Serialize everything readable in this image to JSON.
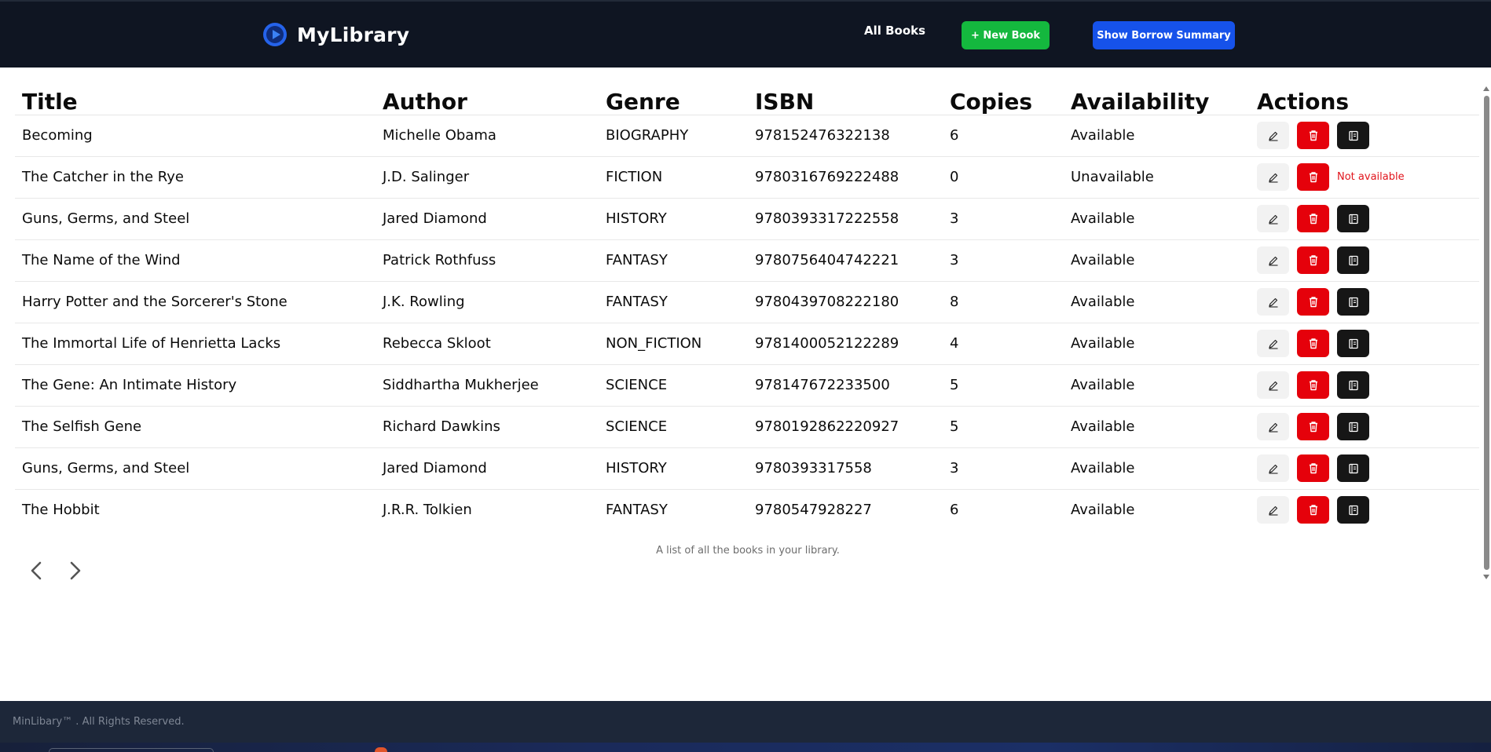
{
  "app": {
    "name": "MyLibrary"
  },
  "nav": {
    "all_books": "All Books",
    "new_book": "+ New Book",
    "borrow_summary": "Show Borrow Summary"
  },
  "table": {
    "headers": [
      "Title",
      "Author",
      "Genre",
      "ISBN",
      "Copies",
      "Availability",
      "Actions"
    ],
    "rows": [
      {
        "title": "Becoming",
        "author": "Michelle Obama",
        "genre": "BIOGRAPHY",
        "isbn": "978152476322138",
        "copies": "6",
        "availability": "Available",
        "available": true
      },
      {
        "title": "The Catcher in the Rye",
        "author": "J.D. Salinger",
        "genre": "FICTION",
        "isbn": "9780316769222488",
        "copies": "0",
        "availability": "Unavailable",
        "available": false
      },
      {
        "title": "Guns, Germs, and Steel",
        "author": "Jared Diamond",
        "genre": "HISTORY",
        "isbn": "9780393317222558",
        "copies": "3",
        "availability": "Available",
        "available": true
      },
      {
        "title": "The Name of the Wind",
        "author": "Patrick Rothfuss",
        "genre": "FANTASY",
        "isbn": "9780756404742221",
        "copies": "3",
        "availability": "Available",
        "available": true
      },
      {
        "title": "Harry Potter and the Sorcerer's Stone",
        "author": "J.K. Rowling",
        "genre": "FANTASY",
        "isbn": "9780439708222180",
        "copies": "8",
        "availability": "Available",
        "available": true
      },
      {
        "title": "The Immortal Life of Henrietta Lacks",
        "author": "Rebecca Skloot",
        "genre": "NON_FICTION",
        "isbn": "9781400052122289",
        "copies": "4",
        "availability": "Available",
        "available": true
      },
      {
        "title": "The Gene: An Intimate History",
        "author": "Siddhartha Mukherjee",
        "genre": "SCIENCE",
        "isbn": "978147672233500",
        "copies": "5",
        "availability": "Available",
        "available": true
      },
      {
        "title": "The Selfish Gene",
        "author": "Richard Dawkins",
        "genre": "SCIENCE",
        "isbn": "9780192862220927",
        "copies": "5",
        "availability": "Available",
        "available": true
      },
      {
        "title": "Guns, Germs, and Steel",
        "author": "Jared Diamond",
        "genre": "HISTORY",
        "isbn": "9780393317558",
        "copies": "3",
        "availability": "Available",
        "available": true
      },
      {
        "title": "The Hobbit",
        "author": "J.R.R. Tolkien",
        "genre": "FANTASY",
        "isbn": "9780547928227",
        "copies": "6",
        "availability": "Available",
        "available": true
      }
    ],
    "not_available_text": "Not available",
    "caption": "A list of all the books in your library."
  },
  "pagination": {
    "prev_icon": "chevron-left-icon",
    "next_icon": "chevron-right-icon"
  },
  "footer": {
    "text": "MinLibary™ . All Rights Reserved."
  },
  "colors": {
    "nav_bg": "#0f1522",
    "new_book": "#14b83e",
    "summary": "#1652ea",
    "delete": "#e5010b",
    "borrow": "#161616",
    "not_available": "#e1141c",
    "footer_bg": "#1d2739"
  },
  "icons": {
    "edit": "pencil-icon",
    "delete": "trash-icon",
    "borrow": "book-icon",
    "logo": "play-circle-logo"
  }
}
